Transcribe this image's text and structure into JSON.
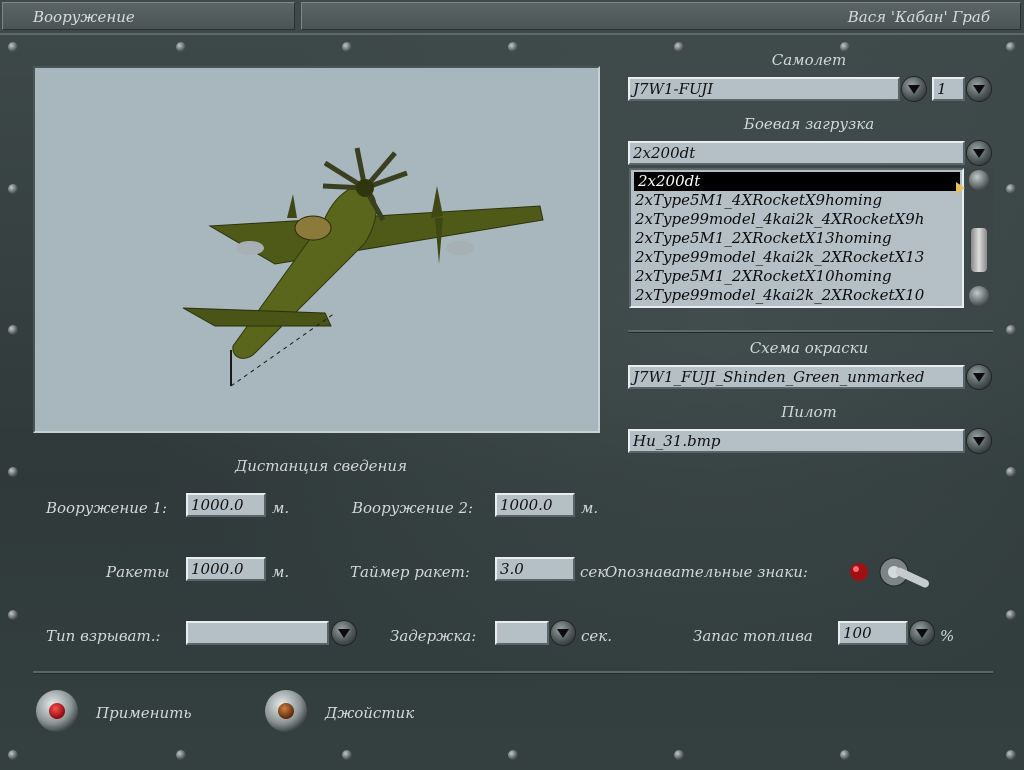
{
  "titlebar": {
    "screen_title": "Вооружение",
    "pilot_name": "Вася 'Кабан' Граб"
  },
  "aircraft": {
    "label": "Самолет",
    "value": "J7W1-FUJI",
    "number": "1"
  },
  "loadout": {
    "label": "Боевая загрузка",
    "value": "2x200dt",
    "items": [
      "2x200dt",
      "2xType5M1_4XRocketX9homing",
      "2xType99model_4kai2k_4XRocketX9h",
      "2xType5M1_2XRocketX13homing",
      "2xType99model_4kai2k_2XRocketX13",
      "2xType5M1_2XRocketX10homing",
      "2xType99model_4kai2k_2XRocketX10"
    ]
  },
  "skin": {
    "label": "Схема окраски",
    "value": "J7W1_FUJI_Shinden_Green_unmarked"
  },
  "pilot": {
    "label": "Пилот",
    "value": "Hu_31.bmp"
  },
  "convergence": {
    "heading": "Дистанция сведения",
    "weapon1_label": "Вооружение 1:",
    "weapon1_value": "1000.0",
    "weapon1_unit": "м.",
    "weapon2_label": "Вооружение 2:",
    "weapon2_value": "1000.0",
    "weapon2_unit": "м.",
    "rockets_label": "Ракеты",
    "rockets_value": "1000.0",
    "rockets_unit": "м.",
    "timer_label": "Таймер ракет:",
    "timer_value": "3.0",
    "timer_unit": "сек",
    "markings_label": "Опознавательные знаки:",
    "fuse_label": "Тип взрыват.:",
    "fuse_value": "",
    "delay_label": "Задержка:",
    "delay_value": "",
    "delay_unit": "сек.",
    "fuel_label": "Запас топлива",
    "fuel_value": "100",
    "fuel_unit": "%"
  },
  "actions": {
    "apply": "Применить",
    "joystick": "Джойстик"
  },
  "colors": {
    "accent_red": "#c0141a",
    "panel": "#344040",
    "field": "#b4c0c6"
  }
}
